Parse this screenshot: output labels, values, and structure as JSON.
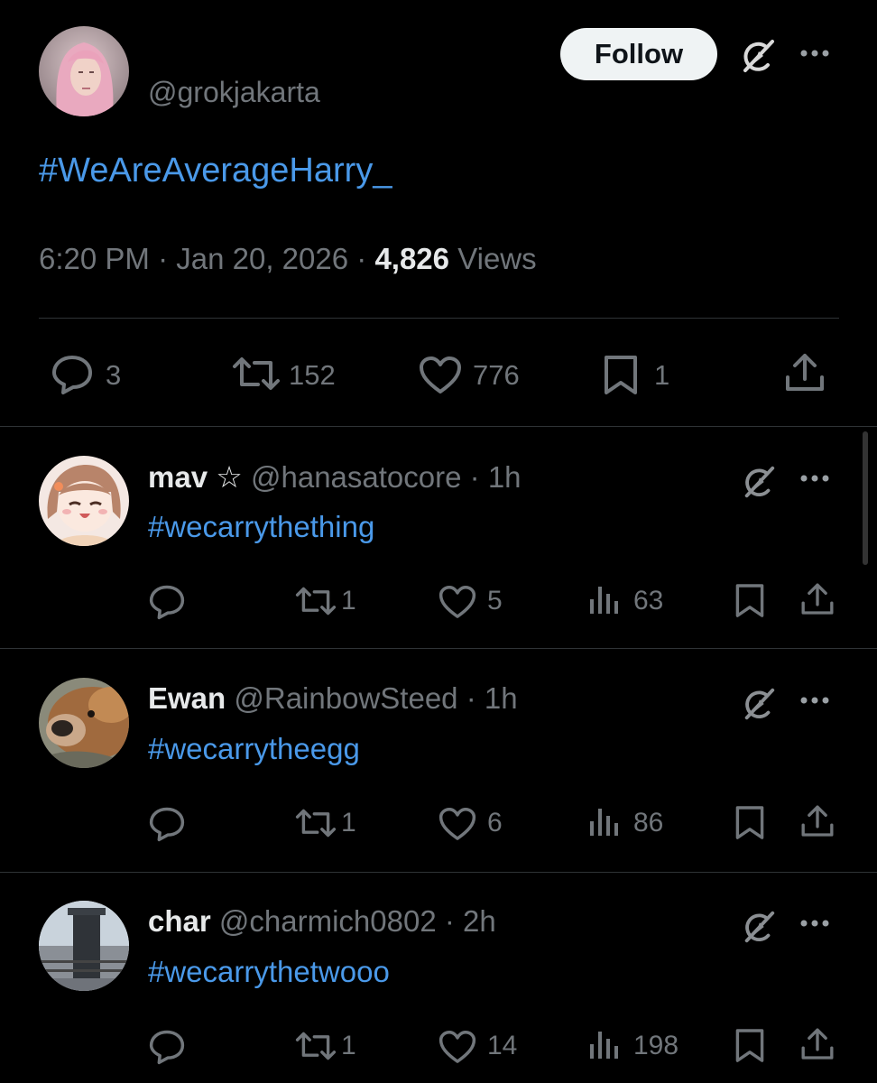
{
  "main_post": {
    "handle": "@grokjakarta",
    "follow_label": "Follow",
    "text": "#WeAreAverageHarry_",
    "time": "6:20 PM",
    "sep": "·",
    "date": "Jan 20, 2026",
    "views_count": "4,826",
    "views_label": "Views",
    "actions": {
      "replies": "3",
      "reposts": "152",
      "likes": "776",
      "bookmarks": "1"
    }
  },
  "replies": [
    {
      "name": "mav",
      "star": "☆",
      "handle": "@hanasatocore",
      "dot": "·",
      "time": "1h",
      "text": "#wecarrythething",
      "reposts": "1",
      "likes": "5",
      "views": "63"
    },
    {
      "name": "Ewan",
      "handle": "@RainbowSteed",
      "dot": "·",
      "time": "1h",
      "text": "#wecarrytheegg",
      "reposts": "1",
      "likes": "6",
      "views": "86"
    },
    {
      "name": "char",
      "handle": "@charmich0802",
      "dot": "·",
      "time": "2h",
      "text": "#wecarrythetwooo",
      "reposts": "1",
      "likes": "14",
      "views": "198"
    }
  ],
  "colors": {
    "background": "#000000",
    "text": "#e7e9ea",
    "muted": "#71767b",
    "link": "#4a99e9",
    "divider": "#2f3336"
  },
  "icons": [
    "grok-icon",
    "more-icon",
    "reply-icon",
    "repost-icon",
    "like-icon",
    "bookmark-icon",
    "share-icon",
    "views-icon"
  ]
}
